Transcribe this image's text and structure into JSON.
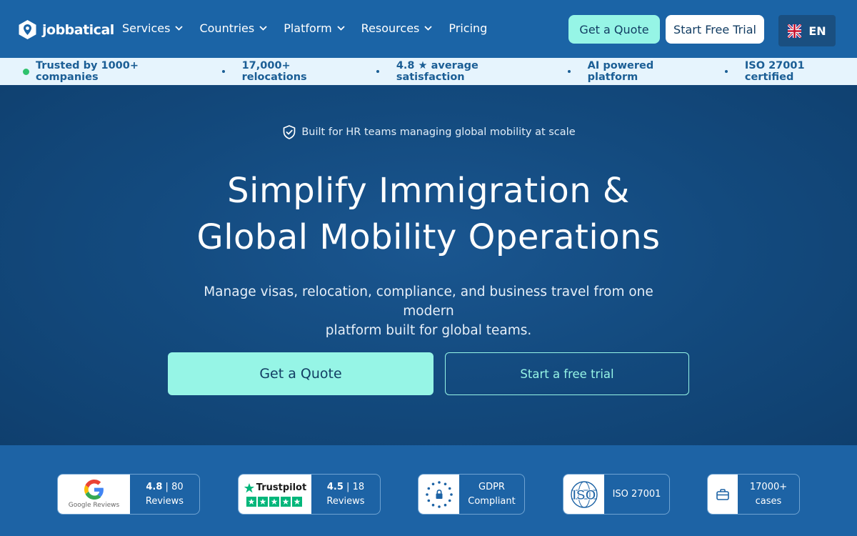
{
  "brand": {
    "name": "jobbatical"
  },
  "nav": {
    "menu": [
      {
        "label": "Services",
        "has_dropdown": true
      },
      {
        "label": "Countries",
        "has_dropdown": true
      },
      {
        "label": "Platform",
        "has_dropdown": true
      },
      {
        "label": "Resources",
        "has_dropdown": true
      },
      {
        "label": "Pricing",
        "has_dropdown": false
      }
    ],
    "quote_label": "Get a Quote",
    "trial_label": "Start Free Trial",
    "language": "EN",
    "language_icon": "uk-flag-icon"
  },
  "trust_strip": {
    "items": [
      "Trusted by 1000+ companies",
      "17,000+ relocations",
      "4.8 ★ average satisfaction",
      "AI powered platform",
      "ISO 27001 certified"
    ]
  },
  "hero": {
    "eyebrow": "Built for HR teams managing global mobility at scale",
    "headline_line1": "Simplify Immigration &",
    "headline_line2": "Global Mobility Operations",
    "subhead_line1": "Manage visas, relocation, compliance, and business travel from one modern",
    "subhead_line2": "platform built for global teams.",
    "cta_primary": "Get a Quote",
    "cta_secondary": "Start a free trial"
  },
  "badges": {
    "google": {
      "logo_label": "Google Reviews",
      "rating": "4.8",
      "sep": "|",
      "count": "80",
      "unit": "Reviews"
    },
    "trustpilot": {
      "logo_label": "Trustpilot",
      "rating": "4.5",
      "sep": "|",
      "count": "18",
      "unit": "Reviews"
    },
    "gdpr": {
      "line1": "GDPR",
      "line2": "Compliant"
    },
    "iso": {
      "logo_label": "ISO",
      "text": "ISO 27001"
    },
    "cases": {
      "line1": "17000+",
      "line2": "cases"
    }
  },
  "colors": {
    "nav_bg": "#1b64a6",
    "accent_mint": "#96f5e6",
    "strip_bg": "#e6f4fd",
    "hero_dark": "#0f3f6e",
    "status_green": "#2fc26d"
  }
}
